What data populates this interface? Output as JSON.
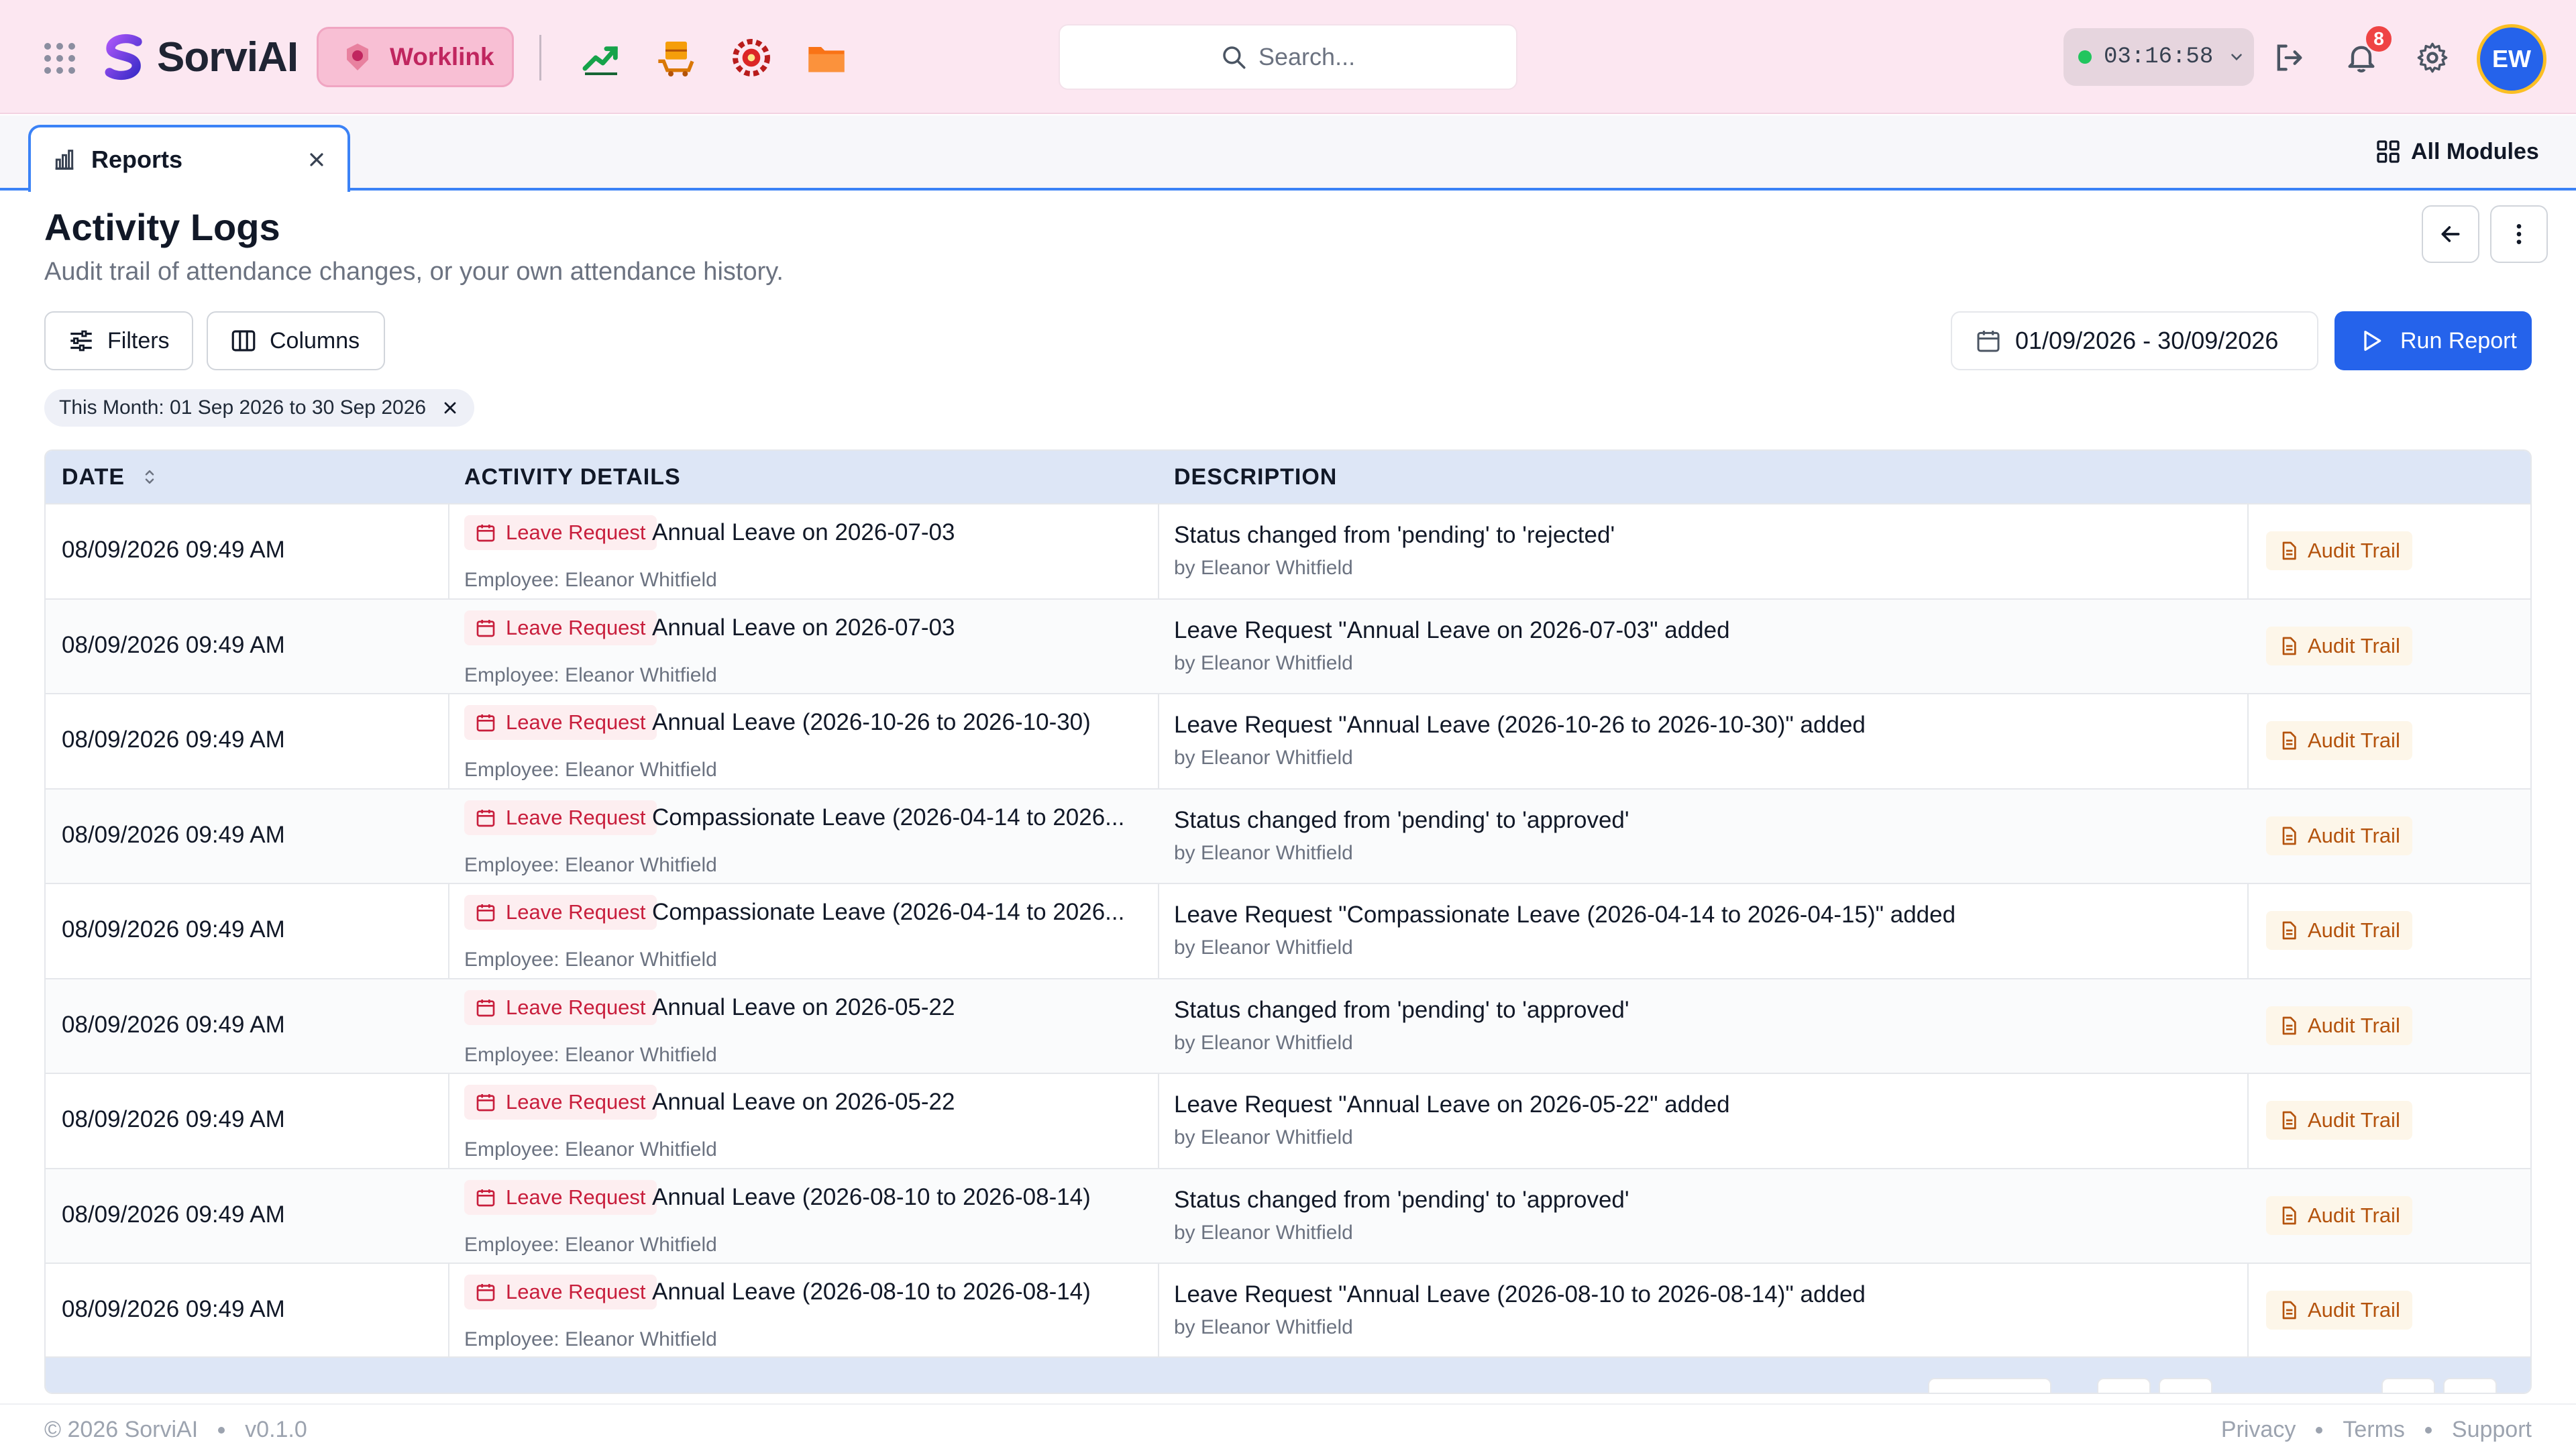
{
  "app": {
    "name": "SorviAI",
    "workspace_button": "Worklink",
    "modules": [
      "growth-chart-icon",
      "package-cart-icon",
      "target-gear-icon",
      "folder-icon"
    ],
    "search_placeholder": "Search...",
    "timer": "03:16:58",
    "notifications_count": "8",
    "user_initials": "EW",
    "colors": {
      "accent": "#2563eb",
      "topbar": "#fce7f1",
      "worklink": "#c0265f",
      "leave": "#c81e3c",
      "audit": "#b4530d"
    }
  },
  "tabs": {
    "active_tab": "Reports",
    "all_modules": "All Modules"
  },
  "page": {
    "title": "Activity Logs",
    "subtitle": "Audit trail of attendance changes, or your own attendance history.",
    "filters_label": "Filters",
    "columns_label": "Columns",
    "date_range": "01/09/2026 - 30/09/2026",
    "run_report": "Run Report",
    "active_filter_chip": "This Month: 01 Sep 2026 to 30 Sep 2026"
  },
  "table": {
    "headers": {
      "date": "DATE",
      "activity": "ACTIVITY DETAILS",
      "description": "DESCRIPTION"
    },
    "rows": [
      {
        "date": "08/09/2026 09:49 AM",
        "type": "Leave Request",
        "title": "Annual Leave on 2026-07-03",
        "employee": "Employee: Eleanor Whitfield",
        "description": "Status changed from 'pending' to 'rejected'",
        "by": "by Eleanor Whitfield",
        "action": "Audit Trail"
      },
      {
        "date": "08/09/2026 09:49 AM",
        "type": "Leave Request",
        "title": "Annual Leave on 2026-07-03",
        "employee": "Employee: Eleanor Whitfield",
        "description": "Leave Request \"Annual Leave on 2026-07-03\" added",
        "by": "by Eleanor Whitfield",
        "action": "Audit Trail"
      },
      {
        "date": "08/09/2026 09:49 AM",
        "type": "Leave Request",
        "title": "Annual Leave (2026-10-26 to 2026-10-30)",
        "employee": "Employee: Eleanor Whitfield",
        "description": "Leave Request \"Annual Leave (2026-10-26 to 2026-10-30)\" added",
        "by": "by Eleanor Whitfield",
        "action": "Audit Trail"
      },
      {
        "date": "08/09/2026 09:49 AM",
        "type": "Leave Request",
        "title": "Compassionate Leave (2026-04-14 to 2026...",
        "employee": "Employee: Eleanor Whitfield",
        "description": "Status changed from 'pending' to 'approved'",
        "by": "by Eleanor Whitfield",
        "action": "Audit Trail"
      },
      {
        "date": "08/09/2026 09:49 AM",
        "type": "Leave Request",
        "title": "Compassionate Leave (2026-04-14 to 2026...",
        "employee": "Employee: Eleanor Whitfield",
        "description": "Leave Request \"Compassionate Leave (2026-04-14 to 2026-04-15)\" added",
        "by": "by Eleanor Whitfield",
        "action": "Audit Trail"
      },
      {
        "date": "08/09/2026 09:49 AM",
        "type": "Leave Request",
        "title": "Annual Leave on 2026-05-22",
        "employee": "Employee: Eleanor Whitfield",
        "description": "Status changed from 'pending' to 'approved'",
        "by": "by Eleanor Whitfield",
        "action": "Audit Trail"
      },
      {
        "date": "08/09/2026 09:49 AM",
        "type": "Leave Request",
        "title": "Annual Leave on 2026-05-22",
        "employee": "Employee: Eleanor Whitfield",
        "description": "Leave Request \"Annual Leave on 2026-05-22\" added",
        "by": "by Eleanor Whitfield",
        "action": "Audit Trail"
      },
      {
        "date": "08/09/2026 09:49 AM",
        "type": "Leave Request",
        "title": "Annual Leave (2026-08-10 to 2026-08-14)",
        "employee": "Employee: Eleanor Whitfield",
        "description": "Status changed from 'pending' to 'approved'",
        "by": "by Eleanor Whitfield",
        "action": "Audit Trail"
      },
      {
        "date": "08/09/2026 09:49 AM",
        "type": "Leave Request",
        "title": "Annual Leave (2026-08-10 to 2026-08-14)",
        "employee": "Employee: Eleanor Whitfield",
        "description": "Leave Request \"Annual Leave (2026-08-10 to 2026-08-14)\" added",
        "by": "by Eleanor Whitfield",
        "action": "Audit Trail"
      }
    ]
  },
  "footer": {
    "copyright": "© 2026 SorviAI",
    "version": "v0.1.0",
    "links": [
      "Privacy",
      "Terms",
      "Support"
    ]
  }
}
